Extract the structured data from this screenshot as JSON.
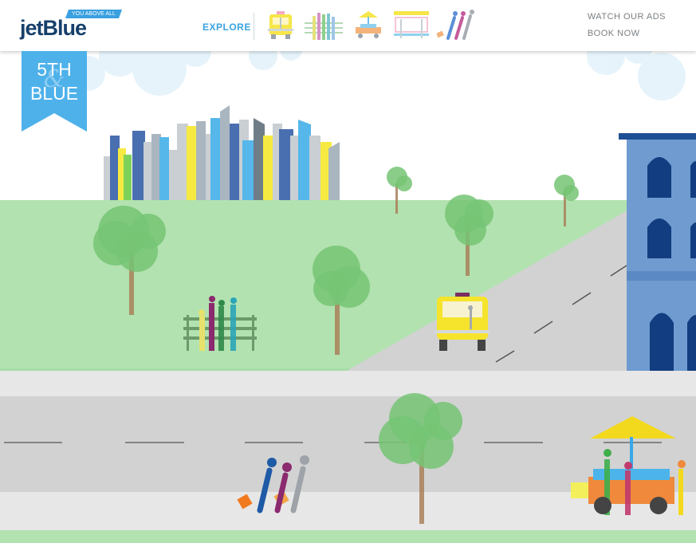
{
  "brand": {
    "logo_text": "jetBlue",
    "tagline": "YOU ABOVE ALL"
  },
  "nav": {
    "explore_label": "EXPLORE",
    "icons": [
      {
        "name": "taxi-nav-icon"
      },
      {
        "name": "bench-people-nav-icon"
      },
      {
        "name": "food-cart-nav-icon"
      },
      {
        "name": "bus-stop-nav-icon"
      },
      {
        "name": "travelers-nav-icon"
      }
    ],
    "watch_ads_label": "WATCH OUR ADS",
    "book_now_label": "BOOK NOW"
  },
  "badge": {
    "line1": "5TH",
    "line2": "&",
    "line3": "BLUE"
  },
  "colors": {
    "accent_blue": "#3ba3df",
    "park_green": "#b2e2b0",
    "road_gray": "#d2d2d2",
    "taxi_yellow": "#f7e64a",
    "building_blue": "#6f9bd0"
  }
}
